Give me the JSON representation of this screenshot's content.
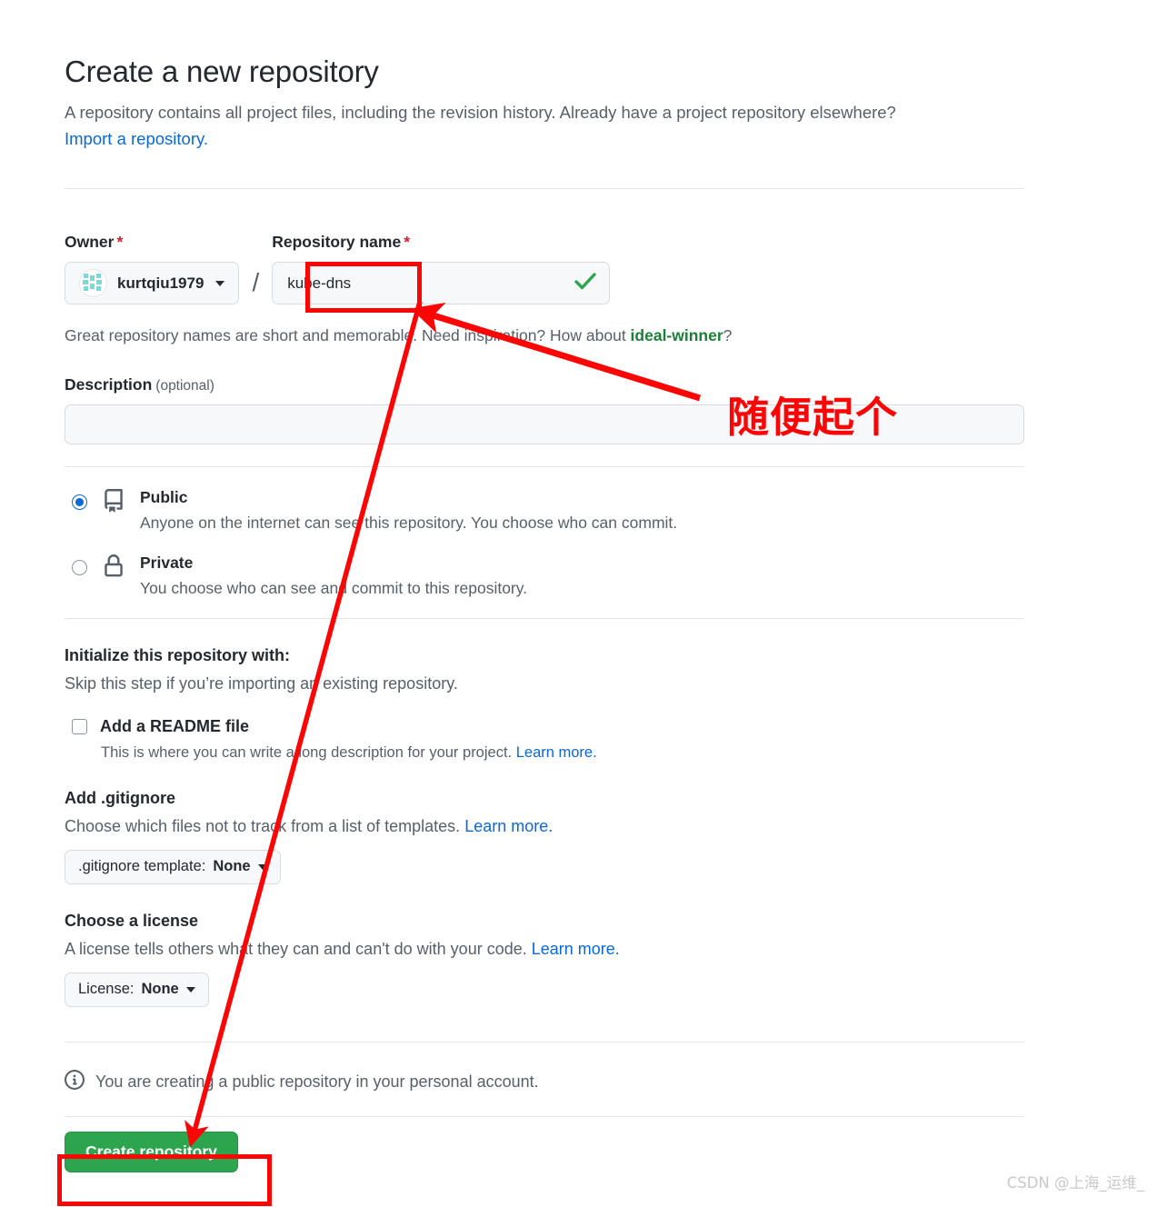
{
  "header": {
    "title": "Create a new repository",
    "subtitle": "A repository contains all project files, including the revision history. Already have a project repository elsewhere?",
    "import_link": "Import a repository."
  },
  "owner_field": {
    "label": "Owner",
    "required_mark": "*",
    "selected_owner": "kurtqiu1979",
    "separator": "/"
  },
  "repo_name_field": {
    "label": "Repository name",
    "required_mark": "*",
    "value": "kube-dns",
    "placeholder": "",
    "valid_icon": "check-icon"
  },
  "helper": {
    "prefix": "Great repository names are short and memorable. Need inspiration? How about ",
    "suggestion": "ideal-winner",
    "suffix": "?"
  },
  "description": {
    "label": "Description",
    "optional": "(optional)",
    "value": "",
    "placeholder": ""
  },
  "visibility": {
    "options": [
      {
        "id": "public",
        "title": "Public",
        "desc": "Anyone on the internet can see this repository. You choose who can commit.",
        "selected": true,
        "icon": "repo-book-icon"
      },
      {
        "id": "private",
        "title": "Private",
        "desc": "You choose who can see and commit to this repository.",
        "selected": false,
        "icon": "lock-icon"
      }
    ]
  },
  "initialize": {
    "title": "Initialize this repository with:",
    "subtitle": "Skip this step if you’re importing an existing repository.",
    "readme": {
      "label": "Add a README file",
      "checked": false,
      "note": "This is where you can write a long description for your project. ",
      "note_link": "Learn more."
    }
  },
  "gitignore": {
    "title": "Add .gitignore",
    "note": "Choose which files not to track from a list of templates. ",
    "note_link": "Learn more.",
    "button_prefix": ".gitignore template: ",
    "button_value": "None"
  },
  "license": {
    "title": "Choose a license",
    "note": "A license tells others what they can and can't do with your code. ",
    "note_link": "Learn more.",
    "button_prefix": "License: ",
    "button_value": "None"
  },
  "footer": {
    "info_icon": "info-icon",
    "info_text": "You are creating a public repository in your personal account.",
    "create_button": "Create repository"
  },
  "annotations": {
    "note_text": "随便起个",
    "highlight_color": "#fb0505",
    "boxes": [
      "repo-name-field",
      "create-repository-button"
    ]
  },
  "watermark": "CSDN @上海_运维_"
}
